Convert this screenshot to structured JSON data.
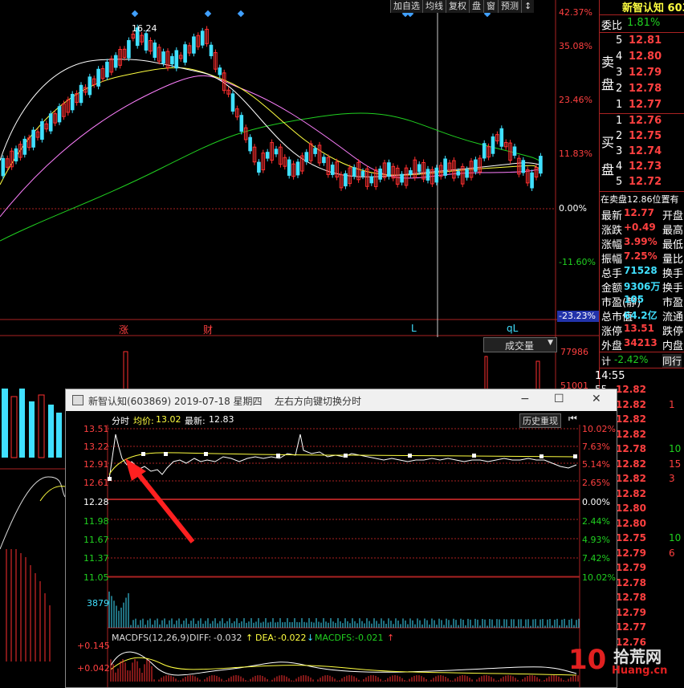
{
  "toolbar": {
    "items": [
      "加自选",
      "均线",
      "复权",
      "盘",
      "窗",
      "预测"
    ],
    "arrow": "↕"
  },
  "main_axis": {
    "labels": [
      "42.37%",
      "35.08%",
      "23.46%",
      "11.83%",
      "0.00%",
      "-11.60%",
      "-23.23%"
    ]
  },
  "peak_label": "16.24",
  "markers": {
    "zhang": "涨",
    "cai": "财",
    "l1": "L",
    "ql": "qL"
  },
  "volume": {
    "selector": "成交量",
    "top_value": "77986",
    "partial_value": "51001"
  },
  "right": {
    "stock_name": "新智认知 603",
    "weibi_label": "委比",
    "weibi_value": "1.81%",
    "sell_label1": "卖",
    "sell_label2": "盘",
    "buy_label1": "买",
    "buy_label2": "盘",
    "sell": [
      [
        "5",
        "12.81"
      ],
      [
        "4",
        "12.80"
      ],
      [
        "3",
        "12.79"
      ],
      [
        "2",
        "12.78"
      ],
      [
        "1",
        "12.77"
      ]
    ],
    "buy": [
      [
        "1",
        "12.76"
      ],
      [
        "2",
        "12.75"
      ],
      [
        "3",
        "12.74"
      ],
      [
        "4",
        "12.73"
      ],
      [
        "5",
        "12.72"
      ]
    ],
    "zmp_label": "在卖盘",
    "zmp_value": "12.86",
    "zmp_suffix": "位置有",
    "stats": [
      {
        "label": "最新",
        "value": "12.77",
        "right": "开盘"
      },
      {
        "label": "涨跌",
        "value": "+0.49",
        "right": "最高"
      },
      {
        "label": "涨幅",
        "value": "3.99%",
        "right": "最低"
      },
      {
        "label": "振幅",
        "value": "7.25%",
        "right": "量比"
      },
      {
        "label": "总手",
        "value": "71528",
        "right": "换手"
      },
      {
        "label": "金额",
        "value": "9306万",
        "right": "换手"
      },
      {
        "label": "市盈(静)",
        "value": "105",
        "right": "市盈"
      },
      {
        "label": "总市值",
        "value": "64.2亿",
        "right": "流通"
      },
      {
        "label": "涨停",
        "value": "13.51",
        "right": "跌停"
      },
      {
        "label": "外盘",
        "value": "34213",
        "right": "内盘"
      }
    ],
    "ji_label": "计",
    "ji_value": "-2.42%",
    "tongxing": "同行",
    "ticks_time": "14:55",
    "ticks": [
      {
        "t": "55",
        "p": "12.82",
        "v": "",
        "c": "red"
      },
      {
        "t": "55",
        "p": "12.82",
        "v": "1",
        "c": "red"
      },
      {
        "t": "55",
        "p": "12.82",
        "v": "",
        "c": "red"
      },
      {
        "t": "55",
        "p": "12.82",
        "v": "",
        "c": "red"
      },
      {
        "t": "55",
        "p": "12.78",
        "v": "10",
        "c": "green"
      },
      {
        "t": "55",
        "p": "12.82",
        "v": "15",
        "c": "red"
      },
      {
        "t": "55",
        "p": "12.82",
        "v": "3",
        "c": "red"
      },
      {
        "t": "55",
        "p": "12.82",
        "v": "",
        "c": "red"
      },
      {
        "t": "55",
        "p": "12.80",
        "v": "",
        "c": "red"
      },
      {
        "t": "55",
        "p": "12.80",
        "v": "",
        "c": "red"
      },
      {
        "t": "55",
        "p": "12.75",
        "v": "10",
        "c": "green"
      },
      {
        "t": "55",
        "p": "12.79",
        "v": "6",
        "c": "red"
      },
      {
        "t": "55",
        "p": "12.79",
        "v": "",
        "c": "red"
      },
      {
        "t": "55",
        "p": "12.78",
        "v": "",
        "c": "red"
      },
      {
        "t": "55",
        "p": "12.78",
        "v": "",
        "c": "red"
      },
      {
        "t": "56",
        "p": "12.79",
        "v": "",
        "c": "red"
      },
      {
        "t": "56",
        "p": "12.77",
        "v": "",
        "c": "red"
      },
      {
        "t": "56",
        "p": "12.76",
        "v": "",
        "c": "red"
      }
    ]
  },
  "popup": {
    "title": "新智认知(603869) 2019-07-18 星期四",
    "hint": "左右方向键切换分时",
    "minimize": "−",
    "maximize": "☐",
    "close": "✕",
    "header_fenshi": "分时",
    "header_junjia_label": "均价:",
    "header_junjia": "13.02",
    "header_zuixin_label": "最新:",
    "header_zuixin": "12.83",
    "history_btn": "历史重现",
    "left_prices": [
      "13.51",
      "13.22",
      "12.91",
      "12.61",
      "12.28",
      "11.98",
      "11.67",
      "11.37",
      "11.05"
    ],
    "right_pcts": [
      "10.02%",
      "7.63%",
      "5.14%",
      "2.65%",
      "0.00%",
      "2.44%",
      "4.93%",
      "7.42%",
      "10.02%"
    ],
    "vol_label": "3879",
    "macd_label": "MACDFS(12,26,9)",
    "diff_label": "DIFF:",
    "diff_value": "-0.032",
    "dea_label": "DEA:",
    "dea_value": "-0.022",
    "macdfs_label": "MACDFS:",
    "macdfs_value": "-0.021",
    "macd_axis": [
      "+0.145",
      "+0.042"
    ]
  },
  "watermark": {
    "num": "10",
    "cn": "拾荒网",
    "url": "Huang.cn"
  },
  "colors": {
    "up": "#ff3030",
    "down": "#40e0ff",
    "ma5": "#ffffff",
    "ma10": "#ffff40",
    "ma20": "#ff80ff",
    "ma60": "#20d020",
    "grid": "#aa2222"
  }
}
